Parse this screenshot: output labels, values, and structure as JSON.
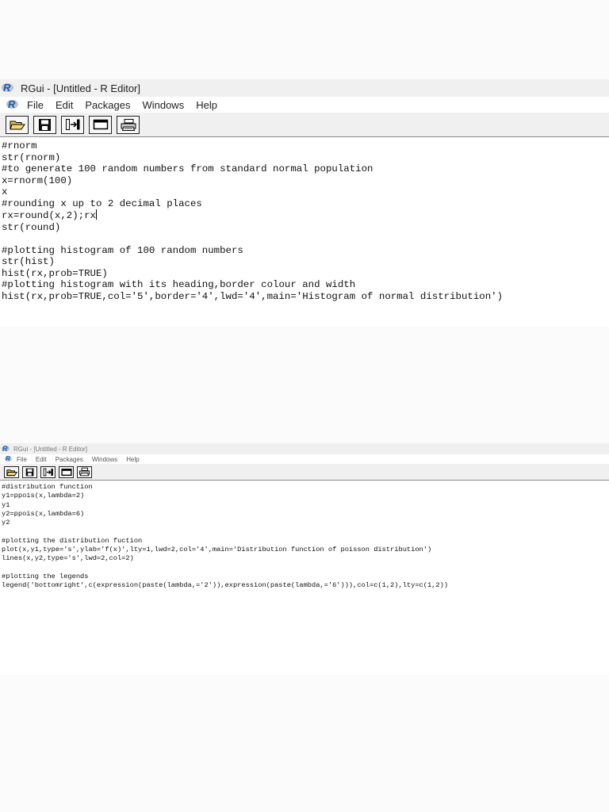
{
  "editor1": {
    "title": "RGui - [Untitled - R Editor]",
    "menu": [
      "File",
      "Edit",
      "Packages",
      "Windows",
      "Help"
    ],
    "toolbar_icons": [
      "open-folder-icon",
      "save-icon",
      "run-line-icon",
      "window-icon",
      "print-icon"
    ],
    "code_lines": [
      "#rnorm",
      "str(rnorm)",
      "#to generate 100 random numbers from standard normal population",
      "x=rnorm(100)",
      "x",
      "#rounding x up to 2 decimal places",
      "rx=round(x,2);rx",
      "str(round)",
      "",
      "#plotting histogram of 100 random numbers",
      "str(hist)",
      "hist(rx,prob=TRUE)",
      "#plotting histogram with its heading,border colour and width",
      "hist(rx,prob=TRUE,col='5',border='4',lwd='4',main='Histogram of normal distribution')"
    ]
  },
  "editor2": {
    "title": "RGui - [Untitled - R Editor]",
    "menu": [
      "File",
      "Edit",
      "Packages",
      "Windows",
      "Help"
    ],
    "toolbar_icons": [
      "open-folder-icon",
      "save-icon",
      "run-line-icon",
      "window-icon",
      "print-icon"
    ],
    "code_lines": [
      "#distribution function",
      "y1=ppois(x,lambda=2)",
      "y1",
      "y2=ppois(x,lambda=6)",
      "y2",
      "",
      "#plotting the distribution fuction",
      "plot(x,y1,type='s',ylab='f(x)',lty=1,lwd=2,col='4',main='Distribution function of poisson distribution')",
      "lines(x,y2,type='s',lwd=2,col=2)",
      "",
      "#plotting the legends",
      "legend('bottomright',c(expression(paste(lambda,='2')),expression(paste(lambda,='6'))),col=c(1,2),lty=c(1,2))"
    ]
  },
  "colors": {
    "titlebar_bg": "#f0f0f0",
    "toolbar_bg": "#f0f0f0",
    "r_logo_blue": "#1f5aa6",
    "folder_yellow": "#e8c44a"
  }
}
